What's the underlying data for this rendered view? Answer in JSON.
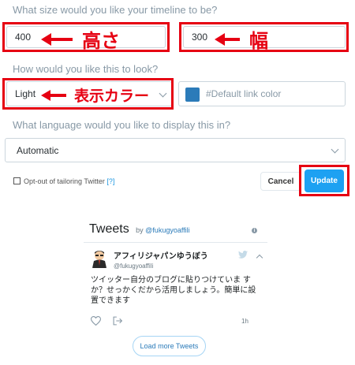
{
  "size_section": {
    "label": "What size would you like your timeline to be?",
    "height_value": "400",
    "width_value": "300",
    "height_annotation": "高さ",
    "width_annotation": "幅"
  },
  "look_section": {
    "label": "How would you like this to look?",
    "theme_value": "Light",
    "theme_annotation": "表示カラー",
    "link_color_placeholder": "#Default link color"
  },
  "language_section": {
    "label": "What language would you like to display this in?",
    "language_value": "Automatic"
  },
  "opt_out": {
    "label": "Opt-out of tailoring Twitter",
    "help_link": "[?]"
  },
  "buttons": {
    "cancel": "Cancel",
    "update": "Update"
  },
  "timeline": {
    "title": "Tweets",
    "by_prefix": "by",
    "handle": "@fukugyoaffili",
    "tweet": {
      "name": "アフィリジャパンゆうぼう",
      "handle": "@fukugyoaffili",
      "lines": [
        "ツイッター自分のブログに貼りつけていま す",
        "か？せっかくだから活用しましょう。簡単に設",
        "置できます"
      ],
      "time": "1h"
    },
    "load_more": "Load more Tweets"
  },
  "colors": {
    "annotation_red": "#e60012",
    "update_blue": "#1da1f2",
    "link_blue": "#2b7bb9"
  }
}
